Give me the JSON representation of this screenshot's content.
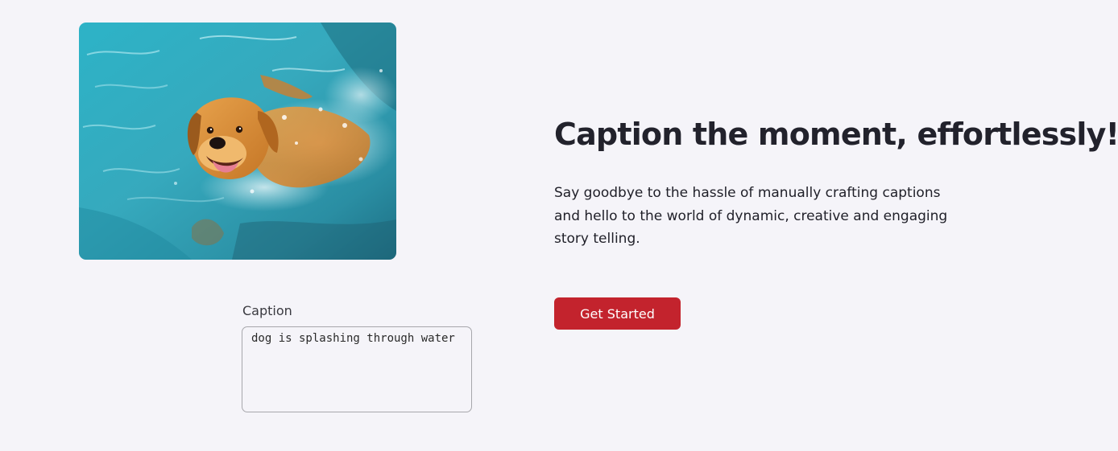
{
  "photo": {
    "subject": "golden retriever swimming in a pool"
  },
  "caption": {
    "label": "Caption",
    "value": "dog is splashing through water"
  },
  "hero": {
    "title": "Caption the moment, effortlessly!",
    "subtitle": "Say goodbye to the hassle of manually crafting captions and hello to the world of dynamic, creative and engaging story telling."
  },
  "cta": {
    "label": "Get Started"
  },
  "colors": {
    "background": "#f5f4f9",
    "accent": "#c3232d",
    "water": "#2aa6bd",
    "heading": "#22222c"
  }
}
